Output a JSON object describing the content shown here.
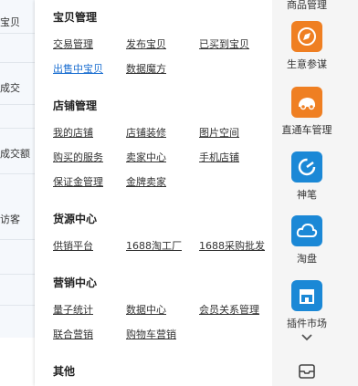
{
  "left_table": {
    "cells": [
      "宝贝",
      "成交",
      "成交额",
      "访客"
    ]
  },
  "menu": {
    "sections": [
      {
        "title": "宝贝管理",
        "links": [
          "交易管理",
          "发布宝贝",
          "已买到宝贝",
          "出售中宝贝",
          "数据魔方"
        ]
      },
      {
        "title": "店铺管理",
        "links": [
          "我的店铺",
          "店铺装修",
          "图片空间",
          "购买的服务",
          "卖家中心",
          "手机店铺",
          "保证金管理",
          "金牌卖家"
        ]
      },
      {
        "title": "货源中心",
        "links": [
          "供销平台",
          "1688淘工厂",
          "1688采购批发"
        ]
      },
      {
        "title": "营销中心",
        "links": [
          "量子统计",
          "数据中心",
          "会员关系管理",
          "联合营销",
          "购物车营销"
        ]
      },
      {
        "title": "其他",
        "links": []
      }
    ],
    "active_link": "出售中宝贝"
  },
  "sidebar": {
    "top_label": "商品管理",
    "tools": [
      {
        "label": "生意参谋",
        "icon": "compass-icon",
        "color": "#ef7f22"
      },
      {
        "label": "直通车管理",
        "icon": "car-icon",
        "color": "#ef7f22"
      },
      {
        "label": "神笔",
        "icon": "pen-icon",
        "color": "#1b88d6"
      },
      {
        "label": "淘盘",
        "icon": "cloud-icon",
        "color": "#1b88d6"
      },
      {
        "label": "插件市场",
        "icon": "store-icon",
        "color": "#1b88d6"
      }
    ],
    "more_icon": "chevron-down-icon",
    "bottom_icon": "tray-icon"
  },
  "colors": {
    "active_link": "#1c6fd1",
    "orange": "#ef7f22",
    "blue": "#1b88d6"
  }
}
